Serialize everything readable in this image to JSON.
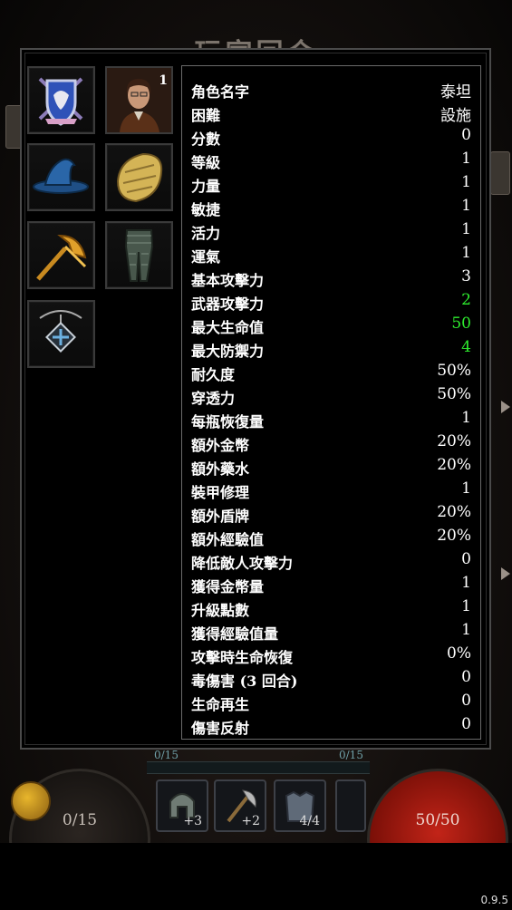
{
  "background": {
    "title": "玩家回合"
  },
  "character": {
    "portrait_badge": "1",
    "equipment_slots": [
      {
        "icon": "class-shield-crest-icon"
      },
      {
        "icon": "character-portrait"
      },
      {
        "icon": "wizard-hat-icon"
      },
      {
        "icon": "leather-armor-icon"
      },
      {
        "icon": "golden-axe-icon"
      },
      {
        "icon": "chainmail-pants-icon"
      },
      {
        "icon": "amulet-icon"
      }
    ]
  },
  "stats": [
    {
      "label": "角色名字",
      "value": "泰坦"
    },
    {
      "label": "困難",
      "value": "設施"
    },
    {
      "label": "分數",
      "value": "0"
    },
    {
      "label": "等級",
      "value": "1"
    },
    {
      "label": "力量",
      "value": "1"
    },
    {
      "label": "敏捷",
      "value": "1"
    },
    {
      "label": "活力",
      "value": "1"
    },
    {
      "label": "運氣",
      "value": "1"
    },
    {
      "label": "基本攻擊力",
      "value": "3"
    },
    {
      "label": "武器攻擊力",
      "value": "2",
      "highlight": true
    },
    {
      "label": "最大生命值",
      "value": "50",
      "highlight": true
    },
    {
      "label": "最大防禦力",
      "value": "4",
      "highlight": true
    },
    {
      "label": "耐久度",
      "value": "50%"
    },
    {
      "label": "穿透力",
      "value": "50%"
    },
    {
      "label": "每瓶恢復量",
      "value": "1"
    },
    {
      "label": "額外金幣",
      "value": "20%"
    },
    {
      "label": "額外藥水",
      "value": "20%"
    },
    {
      "label": "裝甲修理",
      "value": "1"
    },
    {
      "label": "額外盾牌",
      "value": "20%"
    },
    {
      "label": "額外經驗值",
      "value": "20%"
    },
    {
      "label": "降低敵人攻擊力",
      "value": "0"
    },
    {
      "label": "獲得金幣量",
      "value": "1"
    },
    {
      "label": "升級點數",
      "value": "1"
    },
    {
      "label": "獲得經驗值量",
      "value": "1"
    },
    {
      "label": "攻擊時生命恢復",
      "value": "0%"
    },
    {
      "label": "毒傷害 (3 回合)",
      "value": "0"
    },
    {
      "label": "生命再生",
      "value": "0"
    },
    {
      "label": "傷害反射",
      "value": "0"
    }
  ],
  "hud": {
    "left_bar_text": "0/15",
    "right_bar_text": "0/15",
    "armor_orb_text": "0/15",
    "hp_orb_text": "50/50",
    "quick_slots": [
      {
        "icon": "helmet-icon",
        "count": "+3"
      },
      {
        "icon": "axe-icon",
        "count": "+2"
      },
      {
        "icon": "chest-armor-icon",
        "count": "4/4"
      }
    ]
  },
  "colors": {
    "highlight_value": "#2eea2e",
    "hp_orb": "#c22418"
  },
  "version": "0.9.5"
}
